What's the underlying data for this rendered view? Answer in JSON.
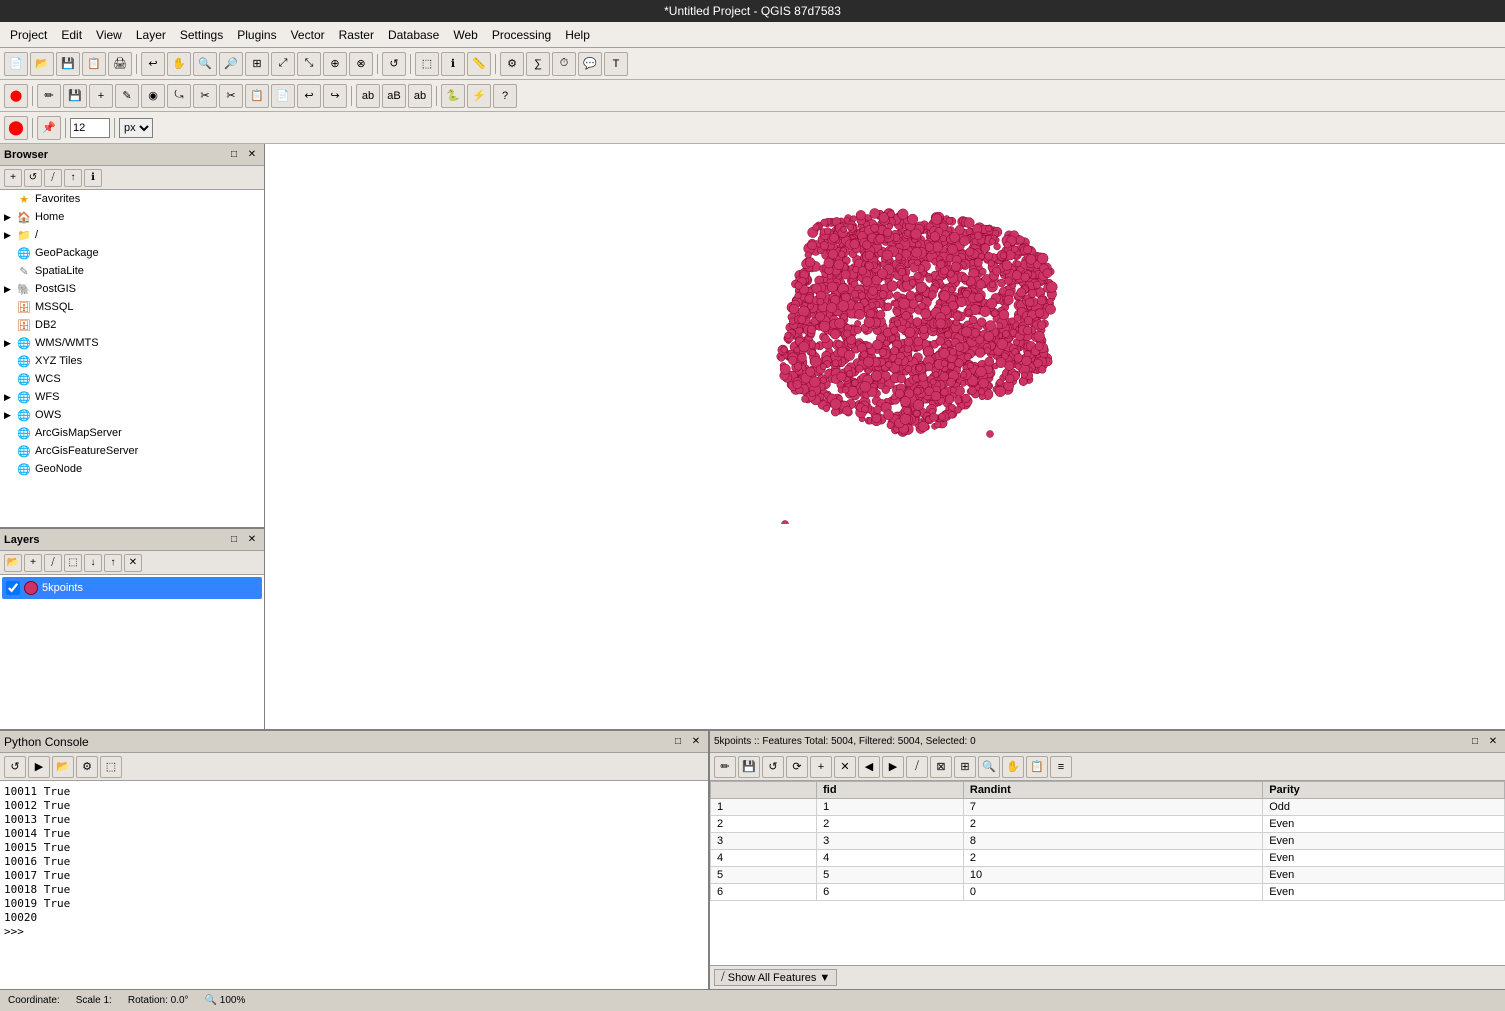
{
  "title": "*Untitled Project - QGIS 87d7583",
  "menu": {
    "items": [
      "Project",
      "Edit",
      "View",
      "Layer",
      "Settings",
      "Plugins",
      "Vector",
      "Raster",
      "Database",
      "Web",
      "Processing",
      "Help"
    ]
  },
  "browser": {
    "title": "Browser",
    "items": [
      {
        "label": "Favorites",
        "icon": "star",
        "indent": 0,
        "expandable": false
      },
      {
        "label": "Home",
        "icon": "folder",
        "indent": 0,
        "expandable": true
      },
      {
        "label": "/",
        "icon": "folder",
        "indent": 0,
        "expandable": true
      },
      {
        "label": "GeoPackage",
        "icon": "globe",
        "indent": 0,
        "expandable": false
      },
      {
        "label": "SpatiaLite",
        "icon": "pen",
        "indent": 0,
        "expandable": false
      },
      {
        "label": "PostGIS",
        "icon": "db",
        "indent": 0,
        "expandable": true
      },
      {
        "label": "MSSQL",
        "icon": "db",
        "indent": 0,
        "expandable": false
      },
      {
        "label": "DB2",
        "icon": "db",
        "indent": 0,
        "expandable": false
      },
      {
        "label": "WMS/WMTS",
        "icon": "globe",
        "indent": 0,
        "expandable": true
      },
      {
        "label": "XYZ Tiles",
        "icon": "globe",
        "indent": 0,
        "expandable": false
      },
      {
        "label": "WCS",
        "icon": "globe",
        "indent": 0,
        "expandable": false
      },
      {
        "label": "WFS",
        "icon": "globe",
        "indent": 0,
        "expandable": true
      },
      {
        "label": "OWS",
        "icon": "globe",
        "indent": 0,
        "expandable": true
      },
      {
        "label": "ArcGisMapServer",
        "icon": "globe",
        "indent": 0,
        "expandable": false
      },
      {
        "label": "ArcGisFeatureServer",
        "icon": "globe",
        "indent": 0,
        "expandable": false
      },
      {
        "label": "GeoNode",
        "icon": "globe",
        "indent": 0,
        "expandable": false
      }
    ]
  },
  "layers": {
    "title": "Layers",
    "items": [
      {
        "label": "5kpoints",
        "checked": true,
        "active": true
      }
    ]
  },
  "python_console": {
    "title": "Python Console",
    "lines": [
      "10011 True",
      "10012 True",
      "10013 True",
      "10014 True",
      "10015 True",
      "10016 True",
      "10017 True",
      "10018 True",
      "10019 True",
      "10020"
    ],
    "prompt": ">>>"
  },
  "attr_table": {
    "header": "5kpoints :: Features Total: 5004, Filtered: 5004, Selected: 0",
    "columns": [
      "fid",
      "Randint",
      "Parity"
    ],
    "rows": [
      {
        "row_num": 1,
        "fid": 1,
        "Randint": 7,
        "Parity": "Odd"
      },
      {
        "row_num": 2,
        "fid": 2,
        "Randint": 2,
        "Parity": "Even"
      },
      {
        "row_num": 3,
        "fid": 3,
        "Randint": 8,
        "Parity": "Even"
      },
      {
        "row_num": 4,
        "fid": 4,
        "Randint": 2,
        "Parity": "Even"
      },
      {
        "row_num": 5,
        "fid": 5,
        "Randint": 10,
        "Parity": "Even"
      },
      {
        "row_num": 6,
        "fid": 6,
        "Randint": 0,
        "Parity": "Even"
      }
    ],
    "footer": "Show All Features"
  },
  "toolbar_font_size": "12",
  "toolbar_font_unit": "px",
  "icons": {
    "star": "★",
    "folder": "📁",
    "globe": "🌐",
    "db": "🗄",
    "expand": "▶",
    "collapse": "▼",
    "check": "✓",
    "pin": "📌",
    "filter": "⧸",
    "refresh": "↻",
    "up": "↑",
    "info": "ℹ",
    "pencil": "✏",
    "close": "✕",
    "float": "□",
    "dots_color": "#cc3366",
    "dots_outline": "#880022"
  }
}
